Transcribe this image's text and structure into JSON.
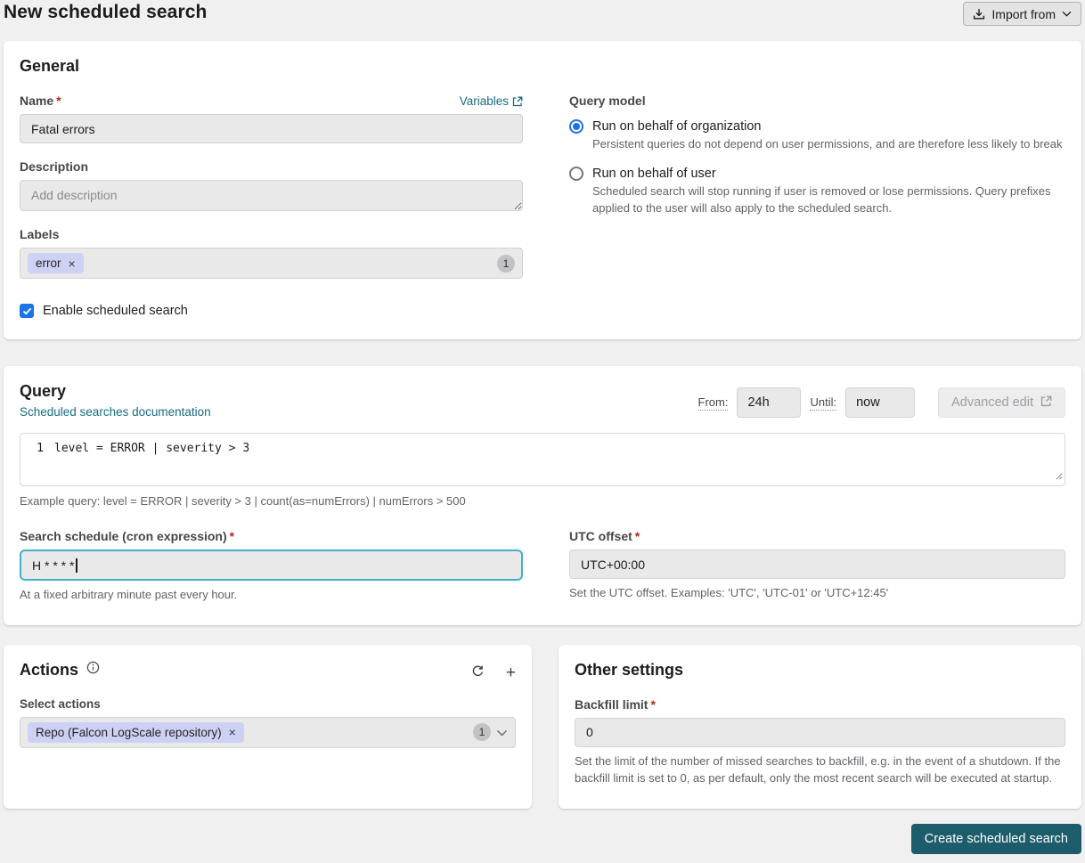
{
  "header": {
    "title": "New scheduled search",
    "import_button": "Import from"
  },
  "icons": {
    "close": "×",
    "plus": "+"
  },
  "colors": {
    "accent_teal": "#1d5c6b",
    "link_teal": "#176b80",
    "focus_border": "#41b1c9",
    "radio_checkbox_blue": "#1a73e8",
    "chip_lavender": "#cdd1f3",
    "required_red": "#b3261e"
  },
  "general": {
    "heading": "General",
    "name": {
      "label": "Name",
      "required": "*",
      "variables_link": "Variables",
      "value": "Fatal errors"
    },
    "description": {
      "label": "Description",
      "placeholder": "Add description"
    },
    "labels": {
      "label": "Labels",
      "chips": [
        {
          "text": "error"
        }
      ],
      "count": "1"
    },
    "enable_checkbox": {
      "label": "Enable scheduled search",
      "checked": true
    },
    "query_model": {
      "label": "Query model",
      "options": [
        {
          "label": "Run on behalf of organization",
          "description": "Persistent queries do not depend on user permissions, and are therefore less likely to break",
          "selected": true
        },
        {
          "label": "Run on behalf of user",
          "description": "Scheduled search will stop running if user is removed or lose permissions. Query prefixes applied to the user will also apply to the scheduled search.",
          "selected": false
        }
      ]
    }
  },
  "query": {
    "heading": "Query",
    "doc_link": "Scheduled searches documentation",
    "time_range": {
      "from_label": "From:",
      "from_value": "24h",
      "until_label": "Until:",
      "until_value": "now"
    },
    "advanced_edit_button": "Advanced edit",
    "editor": {
      "line_number": "1",
      "code": "level = ERROR | severity > 3"
    },
    "example": "Example query: level = ERROR | severity > 3 | count(as=numErrors) | numErrors > 500",
    "schedule": {
      "label": "Search schedule (cron expression)",
      "required": "*",
      "value": "H * * * *",
      "help": "At a fixed arbitrary minute past every hour."
    },
    "utc_offset": {
      "label": "UTC offset",
      "required": "*",
      "value": "UTC+00:00",
      "help": "Set the UTC offset. Examples: 'UTC', 'UTC-01' or 'UTC+12:45'"
    }
  },
  "actions": {
    "heading": "Actions",
    "select_label": "Select actions",
    "selected_chip": "Repo (Falcon LogScale repository)",
    "count": "1"
  },
  "other_settings": {
    "heading": "Other settings",
    "backfill": {
      "label": "Backfill limit",
      "required": "*",
      "value": "0",
      "help": "Set the limit of the number of missed searches to backfill, e.g. in the event of a shutdown. If the backfill limit is set to 0, as per default, only the most recent search will be executed at startup."
    }
  },
  "footer": {
    "create_button": "Create scheduled search"
  }
}
